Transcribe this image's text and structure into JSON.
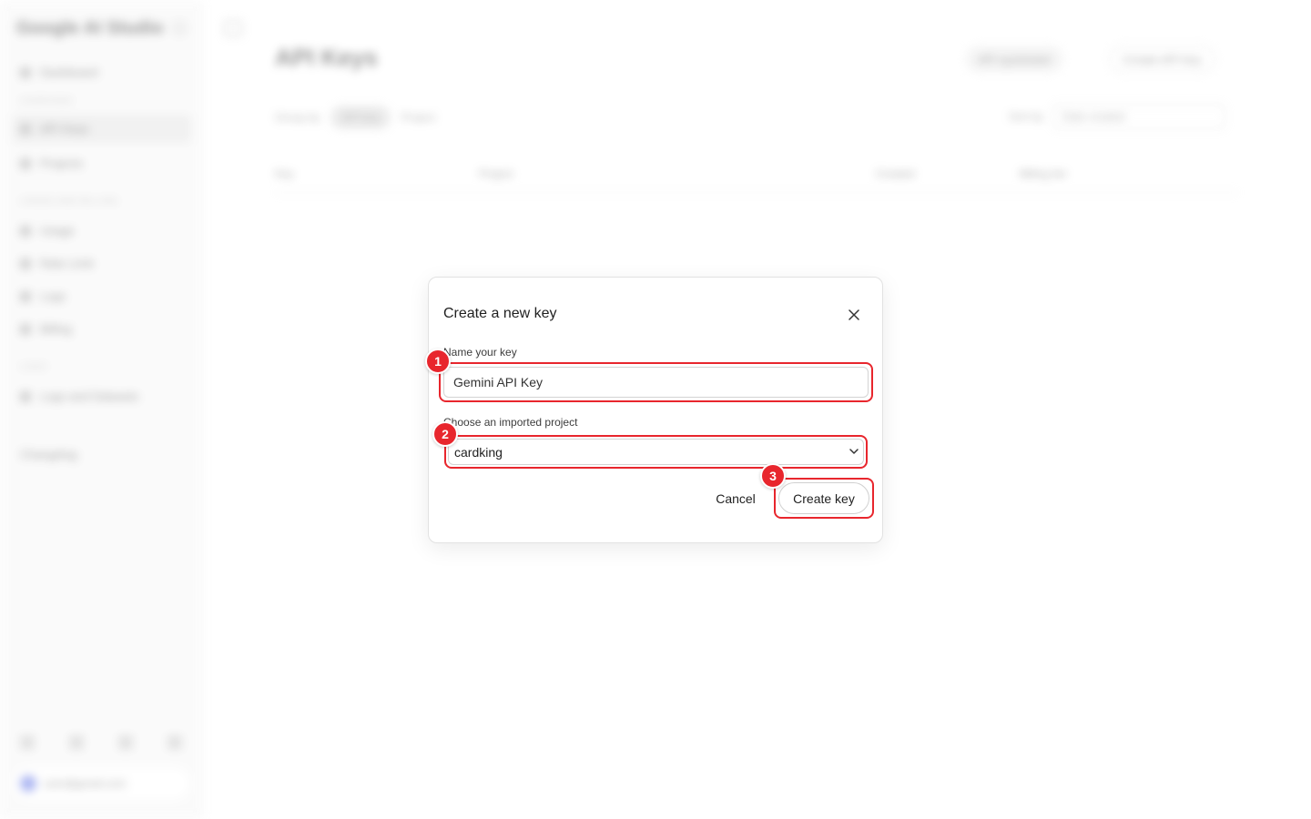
{
  "background": {
    "sidebar": {
      "logo": "Google AI Studio",
      "items": [
        {
          "label": "Dashboard"
        },
        {
          "label": "API Keys"
        },
        {
          "label": "Projects"
        },
        {
          "label": "Usage"
        },
        {
          "label": "Rate Limit"
        },
        {
          "label": "Logs"
        },
        {
          "label": "Billing"
        },
        {
          "label": "Logs and Datasets"
        }
      ],
      "sections": [
        "OVERVIEW",
        "USAGE AND BILLING",
        "LOGS"
      ],
      "changelog": "Changelog",
      "user_email": "user@gmail.com"
    },
    "main": {
      "title": "API Keys",
      "docs_button": "API quickstart",
      "create_button": "Create API key",
      "group_by_label": "Group by",
      "group_by_options": [
        "API key",
        "Project"
      ],
      "sort_label": "Sort by",
      "sort_value": "Date created",
      "columns": [
        "Key",
        "Project",
        "Created",
        "Billing tier"
      ]
    }
  },
  "modal": {
    "title": "Create a new key",
    "close_icon": "close-icon",
    "name_label": "Name your key",
    "name_value": "Gemini API Key",
    "project_label": "Choose an imported project",
    "project_value": "cardking",
    "cancel_label": "Cancel",
    "create_label": "Create key"
  },
  "annotations": {
    "badges": [
      "1",
      "2",
      "3"
    ],
    "highlight_color": "#e8262d"
  }
}
